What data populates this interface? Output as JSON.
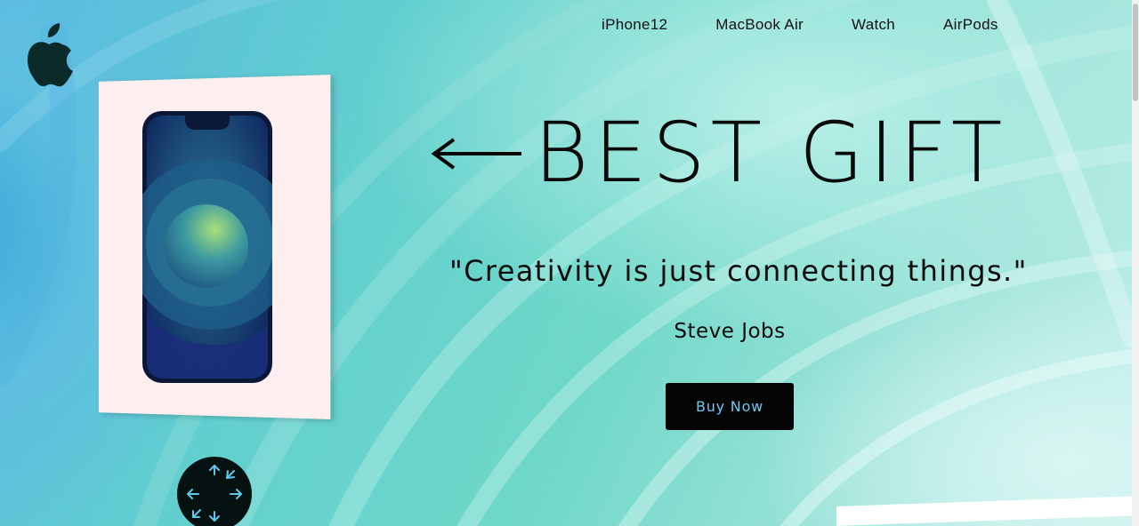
{
  "nav": {
    "links": [
      "iPhone12",
      "MacBook Air",
      "Watch",
      "AirPods"
    ]
  },
  "hero": {
    "headline": "BEST GIFT",
    "quote": "\"Creativity is just connecting things.\"",
    "author": "Steve Jobs",
    "cta_label": "Buy Now"
  },
  "icons": {
    "logo": "apple-logo-icon",
    "arrow": "left-arrow-icon",
    "rotate": "arrows-expand-icon"
  },
  "colors": {
    "cta_background": "#050505",
    "cta_text": "#6ec8f0",
    "box": "#fdeef0",
    "text": "#0a0a0a"
  }
}
